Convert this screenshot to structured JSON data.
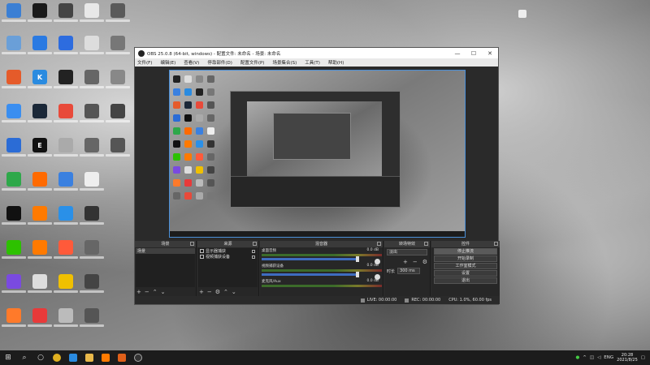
{
  "window": {
    "title": "OBS 25.0.8 (64-bit, windows) - 配置文件: 未命名 - 场景: 未命名",
    "minimize": "—",
    "maximize": "☐",
    "close": "✕"
  },
  "menu": [
    "文件(F)",
    "编辑(E)",
    "查看(V)",
    "停靠部件(D)",
    "配置文件(P)",
    "场景集合(S)",
    "工具(T)",
    "帮助(H)"
  ],
  "docks": {
    "scenes": {
      "title": "场景",
      "items": [
        "场景"
      ]
    },
    "sources": {
      "title": "来源",
      "items": [
        "显示器捕获",
        "视频捕获设备"
      ]
    },
    "mixer": {
      "title": "混音器",
      "channels": [
        {
          "name": "桌面音频",
          "db": "0.0 dB"
        },
        {
          "name": "视频捕获设备",
          "db": "0.0 dB"
        },
        {
          "name": "麦克风/Aux",
          "db": "0.0 dB"
        }
      ]
    },
    "transitions": {
      "title": "转场特效",
      "selected": "淡出",
      "duration_label": "时长",
      "duration": "300 ms"
    },
    "controls": {
      "title": "控件",
      "buttons": [
        "停止推流",
        "开始录制",
        "工作室模式",
        "设置",
        "退出"
      ]
    }
  },
  "status": {
    "live": "LIVE: 00:00:00",
    "rec": "REC: 00:00:00",
    "cpu": "CPU: 1.0%, 60.00 fps"
  },
  "taskbar": {
    "lang": "ENG",
    "time": "20:28",
    "date": "2021/8/25"
  }
}
